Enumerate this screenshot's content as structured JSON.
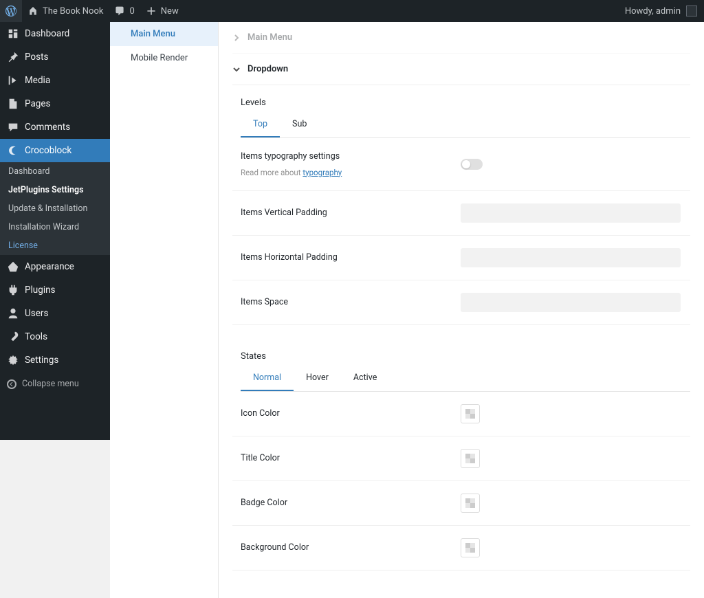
{
  "adminbar": {
    "site_name": "The Book Nook",
    "comment_count": "0",
    "new_label": "New",
    "howdy": "Howdy, admin"
  },
  "sidebar": {
    "items": {
      "dashboard": "Dashboard",
      "posts": "Posts",
      "media": "Media",
      "pages": "Pages",
      "comments": "Comments",
      "crocoblock": "Crocoblock",
      "appearance": "Appearance",
      "plugins": "Plugins",
      "users": "Users",
      "tools": "Tools",
      "settings": "Settings"
    },
    "submenu": {
      "dashboard": "Dashboard",
      "jetplugins": "JetPlugins Settings",
      "update_install": "Update & Installation",
      "wizard": "Installation Wizard",
      "license": "License"
    },
    "collapse": "Collapse menu"
  },
  "subnav": {
    "main_menu": "Main Menu",
    "mobile_render": "Mobile Render"
  },
  "accordion": {
    "main_menu": "Main Menu",
    "dropdown": "Dropdown"
  },
  "levels": {
    "heading": "Levels",
    "tabs": {
      "top": "Top",
      "sub": "Sub"
    },
    "rows": {
      "typography_label": "Items typography settings",
      "typography_read_more": "Read more about ",
      "typography_link": "typography",
      "vertical_padding": "Items Vertical Padding",
      "horizontal_padding": "Items Horizontal Padding",
      "space": "Items Space"
    }
  },
  "states": {
    "heading": "States",
    "tabs": {
      "normal": "Normal",
      "hover": "Hover",
      "active": "Active"
    },
    "rows": {
      "icon_color": "Icon Color",
      "title_color": "Title Color",
      "badge_color": "Badge Color",
      "background_color": "Background Color"
    }
  }
}
